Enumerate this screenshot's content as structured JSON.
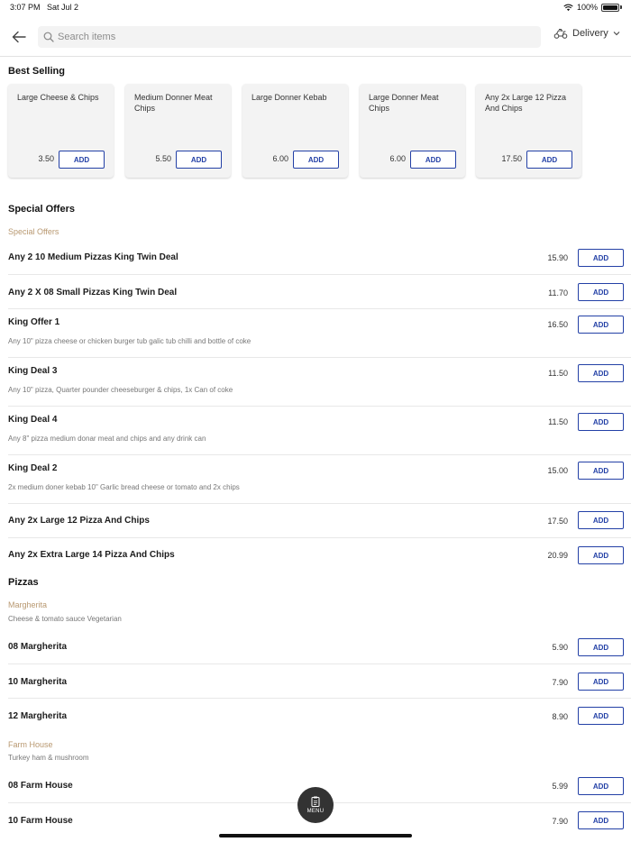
{
  "status_bar": {
    "time": "3:07 PM",
    "date": "Sat Jul 2",
    "battery": "100%"
  },
  "search": {
    "placeholder": "Search items"
  },
  "delivery": {
    "label": "Delivery"
  },
  "best_selling": {
    "title": "Best Selling",
    "add_label": "ADD",
    "items": [
      {
        "name": "Large Cheese & Chips",
        "price": "3.50"
      },
      {
        "name": "Medium Donner Meat Chips",
        "price": "5.50"
      },
      {
        "name": "Large Donner Kebab",
        "price": "6.00"
      },
      {
        "name": "Large Donner Meat Chips",
        "price": "6.00"
      },
      {
        "name": "Any 2x Large 12 Pizza And Chips",
        "price": "17.50"
      }
    ]
  },
  "special_offers": {
    "title": "Special Offers",
    "category": "Special Offers",
    "items": [
      {
        "name": "Any 2 10 Medium Pizzas King Twin Deal",
        "price": "15.90",
        "add": "ADD"
      },
      {
        "name": "Any 2 X 08 Small Pizzas King Twin Deal",
        "price": "11.70",
        "add": "ADD"
      },
      {
        "name": "King Offer 1",
        "desc": "Any 10\" pizza cheese or chicken burger tub galic tub chilli and bottle of coke",
        "price": "16.50",
        "add": "ADD"
      },
      {
        "name": "King Deal 3",
        "desc": "Any 10\" pizza, Quarter pounder cheeseburger & chips, 1x Can of coke",
        "price": "11.50",
        "add": "ADD"
      },
      {
        "name": "King Deal 4",
        "desc": "Any 8\" pizza medium donar meat and chips and any drink can",
        "price": "11.50",
        "add": "ADD"
      },
      {
        "name": "King Deal 2",
        "desc": "2x medium doner kebab 10\" Garlic bread cheese or tomato and 2x chips",
        "price": "15.00",
        "add": "ADD"
      },
      {
        "name": "Any 2x Large 12 Pizza And Chips",
        "price": "17.50",
        "add": "ADD"
      },
      {
        "name": "Any 2x Extra Large 14 Pizza And Chips",
        "price": "20.99",
        "add": "ADD"
      }
    ]
  },
  "pizzas": {
    "title": "Pizzas",
    "margherita": {
      "category": "Margherita",
      "desc": "Cheese & tomato sauce Vegetarian",
      "items": [
        {
          "name": "08 Margherita",
          "price": "5.90",
          "add": "ADD"
        },
        {
          "name": "10 Margherita",
          "price": "7.90",
          "add": "ADD"
        },
        {
          "name": "12 Margherita",
          "price": "8.90",
          "add": "ADD"
        }
      ]
    },
    "farm_house": {
      "category": "Farm House",
      "desc": "Turkey ham & mushroom",
      "items": [
        {
          "name": "08 Farm House",
          "price": "5.99",
          "add": "ADD"
        },
        {
          "name": "10 Farm House",
          "price": "7.90",
          "add": "ADD"
        }
      ]
    }
  },
  "menu_button": {
    "label": "MENU"
  },
  "colors": {
    "accent": "#2340a6",
    "category": "#b89870",
    "fab": "#333333"
  }
}
